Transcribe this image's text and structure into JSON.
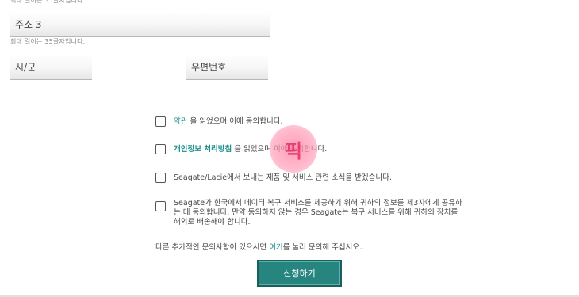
{
  "form": {
    "max_length_hint": "최대 길이는 35글자입니다.",
    "address3_label": "주소 3",
    "city_label": "시/군",
    "postal_label": "우편번호"
  },
  "consents": [
    {
      "link": "약관",
      "text": " 을 읽었으며 이에 동의합니다."
    },
    {
      "link": "개인정보 처리방침",
      "text": " 을 읽었으며 이에 동의합니다."
    },
    {
      "text": "Seagate/Lacie에서 보내는 제품 및 서비스 관련 소식을 받겠습니다."
    },
    {
      "text": "Seagate가 한국에서 데이터 복구 서비스를 제공하기 위해 귀하의 정보를 제3자에게 공유하는 데 동의합니다. 만약 동의하지 않는 경우 Seagate는 복구 서비스를 위해 귀하의 장치를 해외로 배송해야 합니다."
    }
  ],
  "note": {
    "before": "다른 추가적인 문의사항이 있으시면 ",
    "link": "여기",
    "after": "를 눌러 문의해 주십시오.."
  },
  "submit_label": "신청하기",
  "stamp_text": "픽",
  "colors": {
    "link": "#1d8f8a",
    "button": "#27857f",
    "stamp": "#f58aa8"
  }
}
